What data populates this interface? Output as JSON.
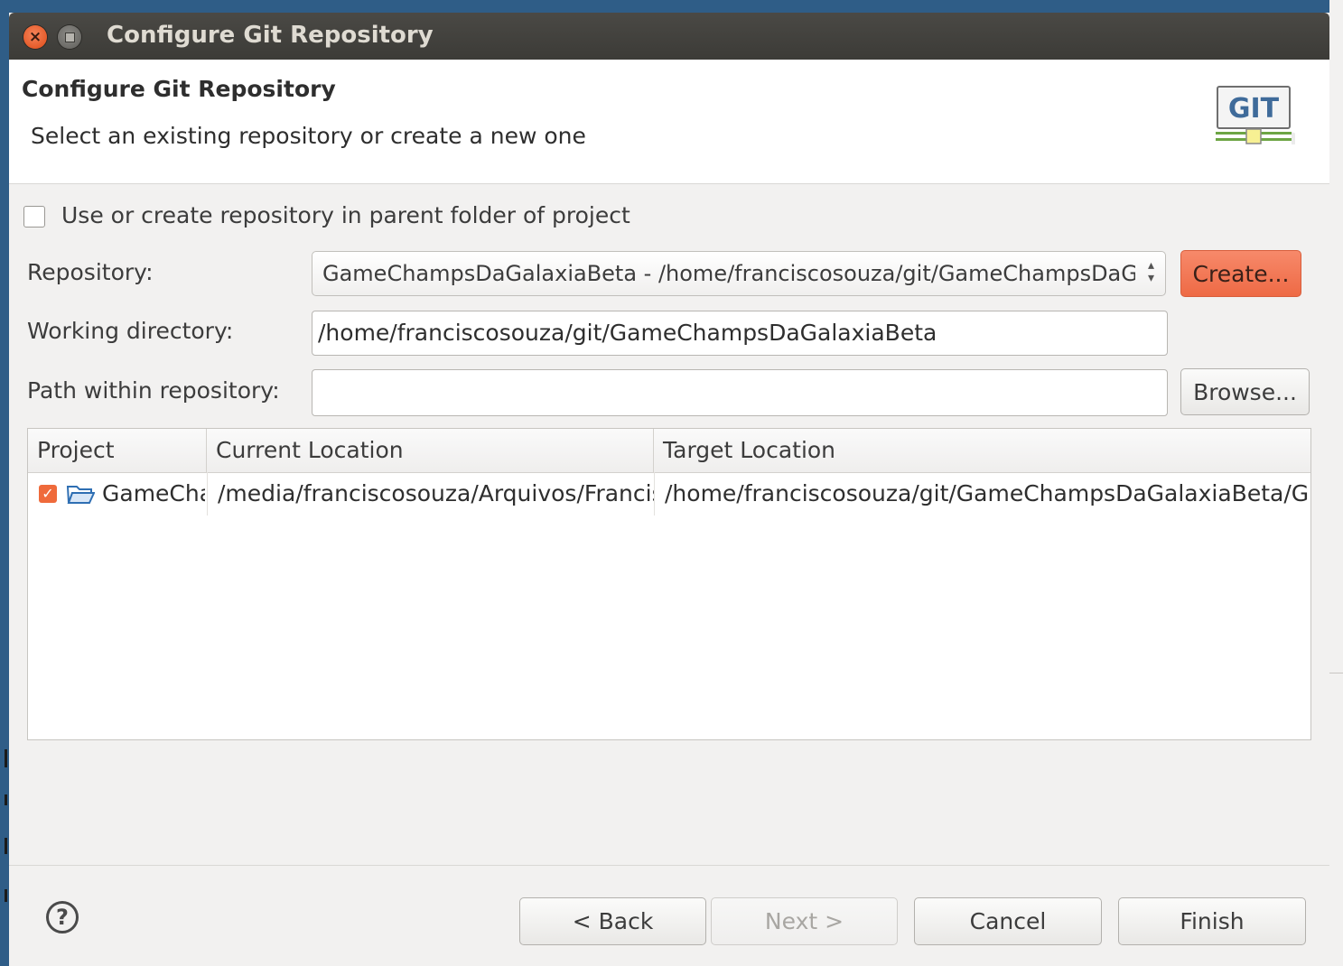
{
  "window": {
    "title": "Configure Git Repository"
  },
  "header": {
    "title": "Configure Git Repository",
    "subtitle": "Select an existing repository or create a new one",
    "logo_text": "GIT"
  },
  "checkbox": {
    "label": "Use or create repository in parent folder of project",
    "checked": false
  },
  "repository": {
    "label": "Repository:",
    "value": "GameChampsDaGalaxiaBeta - /home/franciscosouza/git/GameChampsDaGalaxiaBeta/.git",
    "create_button": "Create..."
  },
  "working_directory": {
    "label": "Working directory:",
    "value": "/home/franciscosouza/git/GameChampsDaGalaxiaBeta"
  },
  "path_within": {
    "label": "Path within repository:",
    "value": "",
    "browse_button": "Browse..."
  },
  "table": {
    "columns": [
      "Project",
      "Current Location",
      "Target Location"
    ],
    "rows": [
      {
        "project": "GameChampsDaGalaxiaBeta",
        "current": "/media/franciscosouza/Arquivos/FranciscoSouza/workspace/GameChampsDaGalaxiaBeta",
        "target": "/home/franciscosouza/git/GameChampsDaGalaxiaBeta/GameChampsDaGalaxiaBeta",
        "checked": true
      }
    ]
  },
  "buttons": {
    "back": "< Back",
    "next": "Next >",
    "cancel": "Cancel",
    "finish": "Finish"
  },
  "icons": {
    "close": "close-icon",
    "minimize": "minimize-icon",
    "help": "help-icon",
    "folder": "folder-icon"
  },
  "colors": {
    "accent": "#ee6a45",
    "titlebar": "#3c3b37"
  }
}
